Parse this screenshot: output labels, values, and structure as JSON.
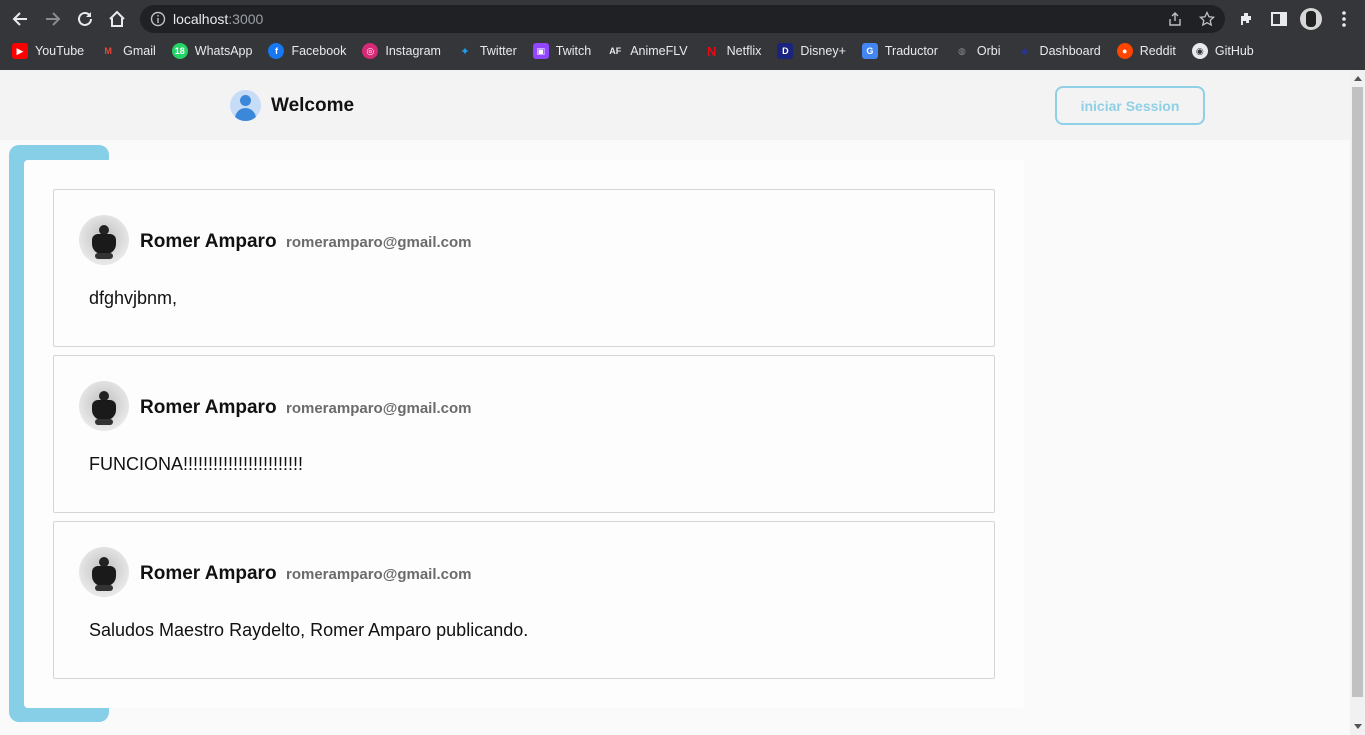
{
  "browser": {
    "url_host": "localhost",
    "url_port": ":3000",
    "bookmarks": [
      {
        "label": "YouTube",
        "icon": "youtube-icon",
        "color": "#ff0000",
        "glyph": "▶"
      },
      {
        "label": "Gmail",
        "icon": "gmail-icon",
        "color": "#35363a",
        "glyph": "M"
      },
      {
        "label": "WhatsApp",
        "icon": "whatsapp-icon",
        "color": "#25d366",
        "glyph": "18"
      },
      {
        "label": "Facebook",
        "icon": "facebook-icon",
        "color": "#1877f2",
        "glyph": "f"
      },
      {
        "label": "Instagram",
        "icon": "instagram-icon",
        "color": "#d62976",
        "glyph": "◎"
      },
      {
        "label": "Twitter",
        "icon": "twitter-icon",
        "color": "#35363a",
        "glyph": "🐦"
      },
      {
        "label": "Twitch",
        "icon": "twitch-icon",
        "color": "#9146ff",
        "glyph": "▣"
      },
      {
        "label": "AnimeFLV",
        "icon": "animeflv-icon",
        "color": "#35363a",
        "glyph": "AF"
      },
      {
        "label": "Netflix",
        "icon": "netflix-icon",
        "color": "#35363a",
        "glyph": "N"
      },
      {
        "label": "Disney+",
        "icon": "disney-icon",
        "color": "#1a237e",
        "glyph": "D"
      },
      {
        "label": "Traductor",
        "icon": "translate-icon",
        "color": "#4285f4",
        "glyph": "G"
      },
      {
        "label": "Orbi",
        "icon": "orbi-icon",
        "color": "#35363a",
        "glyph": "◍"
      },
      {
        "label": "Dashboard",
        "icon": "dashboard-icon",
        "color": "#1a237e",
        "glyph": "◆"
      },
      {
        "label": "Reddit",
        "icon": "reddit-icon",
        "color": "#ff4500",
        "glyph": "●"
      },
      {
        "label": "GitHub",
        "icon": "github-icon",
        "color": "#35363a",
        "glyph": "◉"
      }
    ]
  },
  "header": {
    "title": "Welcome",
    "login_label": "iniciar Session"
  },
  "posts": [
    {
      "name": "Romer Amparo",
      "email": "romeramparo@gmail.com",
      "text": "dfghvjbnm,"
    },
    {
      "name": "Romer Amparo",
      "email": "romeramparo@gmail.com",
      "text": "FUNCIONA!!!!!!!!!!!!!!!!!!!!!!!!"
    },
    {
      "name": "Romer Amparo",
      "email": "romeramparo@gmail.com",
      "text": "Saludos Maestro Raydelto, Romer Amparo publicando."
    }
  ],
  "colors": {
    "accent": "#87cfe7",
    "chrome": "#35363a"
  }
}
